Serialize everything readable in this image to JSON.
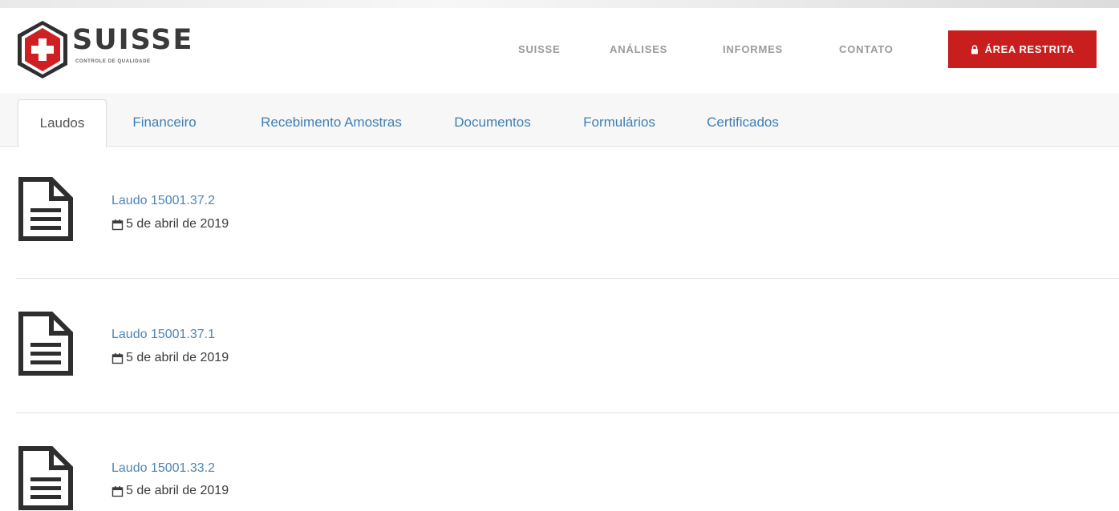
{
  "brand": {
    "name": "SUISSE",
    "tagline": "CONTROLE DE QUALIDADE",
    "colors": {
      "red": "#c81e1e",
      "dark": "#3a3a3a"
    }
  },
  "nav": {
    "items": [
      {
        "label": "SUISSE"
      },
      {
        "label": "ANÁLISES"
      },
      {
        "label": "INFORMES"
      },
      {
        "label": "CONTATO"
      }
    ],
    "restricted_button": {
      "label": "ÁREA RESTRITA",
      "icon": "lock-icon"
    }
  },
  "tabs": [
    {
      "label": "Laudos",
      "active": true
    },
    {
      "label": "Financeiro",
      "active": false
    },
    {
      "label": "Recebimento Amostras",
      "active": false
    },
    {
      "label": "Documentos",
      "active": false
    },
    {
      "label": "Formulários",
      "active": false
    },
    {
      "label": "Certificados",
      "active": false
    }
  ],
  "documents": [
    {
      "title": "Laudo 15001.37.2",
      "date": "5 de abril de 2019",
      "icon": "document-icon"
    },
    {
      "title": "Laudo 15001.37.1",
      "date": "5 de abril de 2019",
      "icon": "document-icon"
    },
    {
      "title": "Laudo 15001.33.2",
      "date": "5 de abril de 2019",
      "icon": "document-icon"
    }
  ],
  "colors": {
    "link": "#4d86b8",
    "accent": "#c81e1e",
    "nav_text": "#9a9a9a"
  }
}
